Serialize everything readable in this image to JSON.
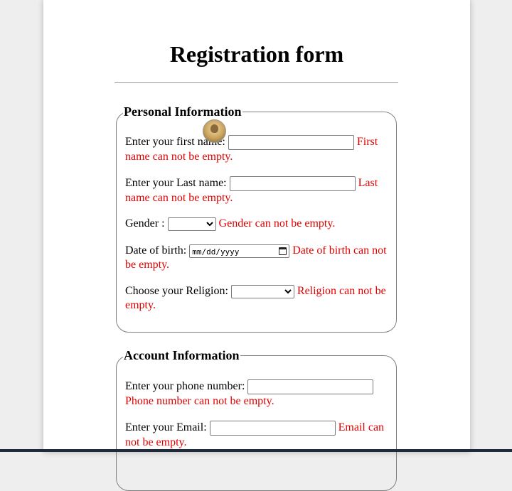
{
  "form": {
    "title": "Registration form"
  },
  "personal": {
    "legend": "Personal Information",
    "first_name": {
      "label": "Enter your first name:",
      "value": "",
      "error": "First name can not be empty."
    },
    "last_name": {
      "label": "Enter your Last name:",
      "value": "",
      "error": "Last name can not be empty."
    },
    "gender": {
      "label": "Gender :",
      "selected": "",
      "error": "Gender can not be empty."
    },
    "dob": {
      "label": "Date of birth:",
      "placeholder": "mm/dd/yyyy",
      "error": "Date of birth can not be empty."
    },
    "religion": {
      "label": "Choose your Religion:",
      "selected": "",
      "error": "Religion can not be empty."
    }
  },
  "account": {
    "legend": "Account Information",
    "phone": {
      "label": "Enter your phone number:",
      "value": "",
      "error": "Phone number can not be empty."
    },
    "email": {
      "label": "Enter your Email:",
      "value": "",
      "error": "Email can not be empty."
    }
  },
  "icons": {
    "calendar": "calendar-icon",
    "avatar": "user-avatar"
  },
  "colors": {
    "error": "#e00000",
    "border": "#808080"
  }
}
